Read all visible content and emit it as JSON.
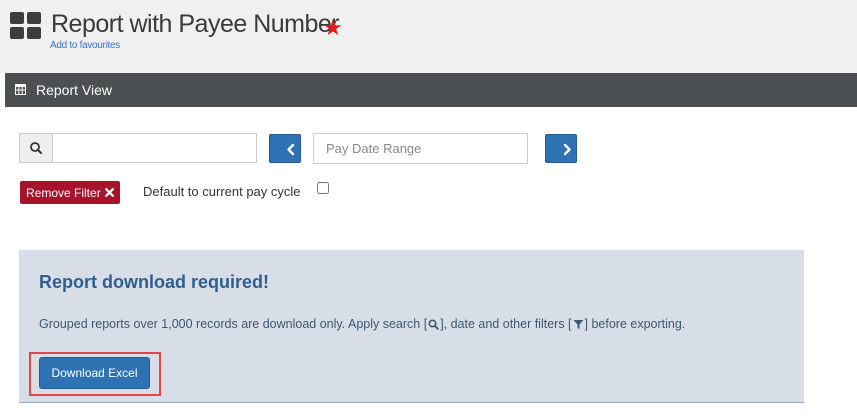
{
  "header": {
    "title": "Report with Payee Number",
    "favourite_icon": "star-icon",
    "favourite_color": "#e01b1b",
    "add_to_favourites": "Add to favourites",
    "app_icon": "dashboard-grid-icon"
  },
  "panel": {
    "title": "Report View",
    "icon": "table-icon",
    "header_color": "#4d5052"
  },
  "filters": {
    "search_value": "",
    "search_icon": "search-icon",
    "prev_icon": "chevron-left-icon",
    "next_icon": "chevron-right-icon",
    "date_range_placeholder": "Pay Date Range",
    "remove_filter_label": "Remove Filter",
    "remove_filter_icon": "close-icon",
    "remove_filter_color": "#a6142b",
    "default_pay_cycle_label": "Default to current pay cycle",
    "default_pay_cycle_checked": false
  },
  "notice": {
    "title": "Report download required!",
    "text_part1": "Grouped reports over 1,000 records are download only. Apply search [",
    "text_part2": "], date and other filters [",
    "text_part3": "] before exporting.",
    "search_icon": "search-icon",
    "filter_icon": "filter-icon",
    "download_button_label": "Download Excel",
    "button_color": "#2f72b3",
    "background_color": "#d8dee8"
  }
}
